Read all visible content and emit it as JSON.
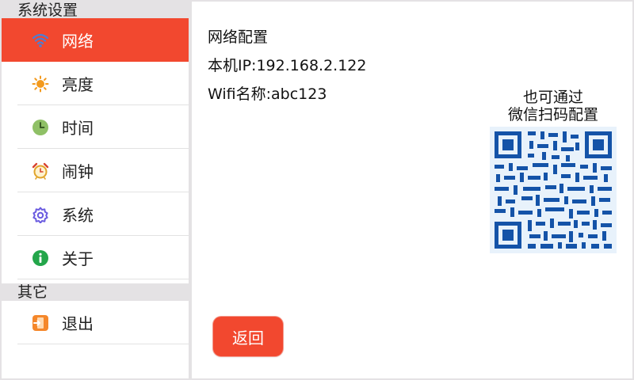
{
  "sidebar": {
    "section_system": "系统设置",
    "section_other": "其它",
    "items": [
      {
        "label": "网络",
        "icon": "wifi-icon",
        "active": true
      },
      {
        "label": "亮度",
        "icon": "sun-icon"
      },
      {
        "label": "时间",
        "icon": "clock-icon"
      },
      {
        "label": "闹钟",
        "icon": "alarm-clock-icon"
      },
      {
        "label": "系统",
        "icon": "gear-icon"
      },
      {
        "label": "关于",
        "icon": "info-icon"
      }
    ],
    "other_items": [
      {
        "label": "退出",
        "icon": "exit-icon"
      }
    ]
  },
  "content": {
    "title": "网络配置",
    "ip": "本机IP:192.168.2.122",
    "wifi": "Wifi名称:abc123",
    "qr_caption_line1": "也可通过",
    "qr_caption_line2": "微信扫码配置",
    "back_label": "返回"
  },
  "colors": {
    "accent": "#f2482f",
    "qr_dark": "#1453a8",
    "qr_light": "#e8f2fb"
  }
}
